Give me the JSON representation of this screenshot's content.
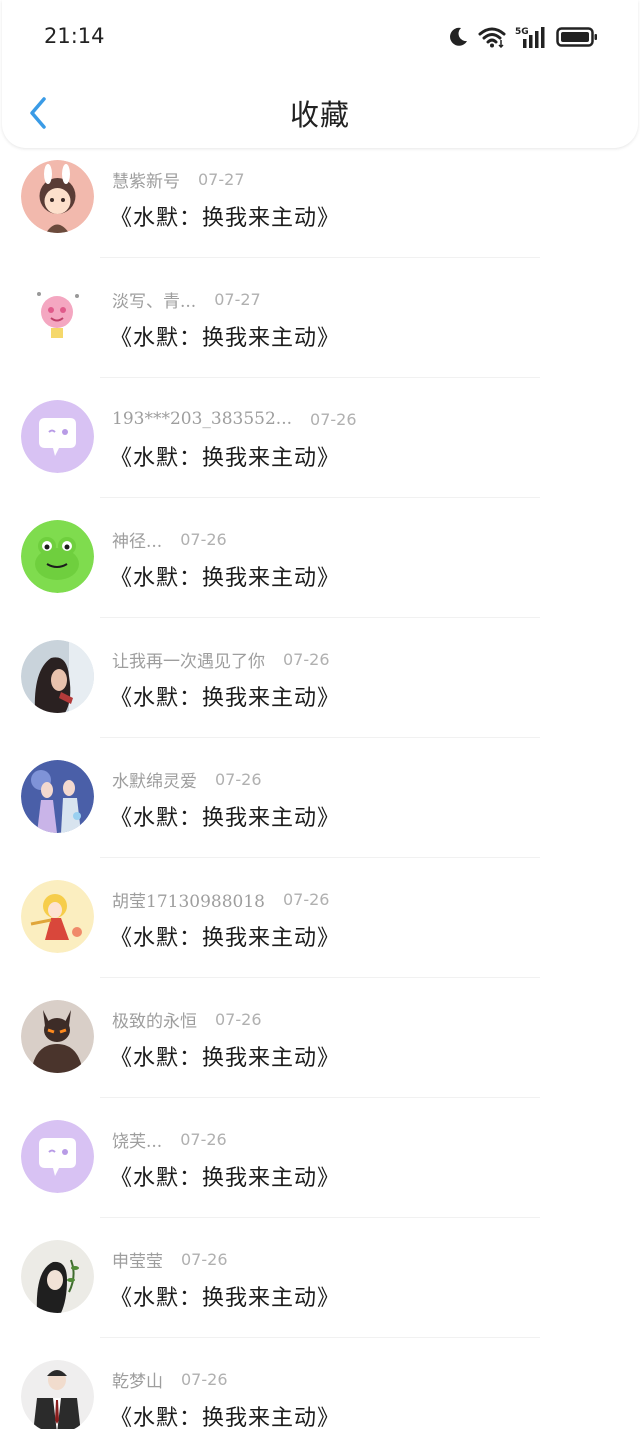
{
  "status_bar": {
    "time": "21:14",
    "network": "5G"
  },
  "header": {
    "title": "收藏",
    "back_icon": "chevron-left-icon",
    "back_color": "#3a9be6"
  },
  "favorites": [
    {
      "user": "慧紫新号",
      "date": "07-27",
      "title": "《水默：换我来主动》",
      "avatar": "anime-girl"
    },
    {
      "user": "淡写、青...",
      "date": "07-27",
      "title": "《水默：换我来主动》",
      "avatar": "pink-cartoon"
    },
    {
      "user": "193***203_383552...",
      "date": "07-26",
      "title": "《水默：换我来主动》",
      "avatar": "default-chat"
    },
    {
      "user": "神径...",
      "date": "07-26",
      "title": "《水默：换我来主动》",
      "avatar": "green-frog"
    },
    {
      "user": "让我再一次遇见了你",
      "date": "07-26",
      "title": "《水默：换我来主动》",
      "avatar": "photo-girl"
    },
    {
      "user": "水默绵灵爱",
      "date": "07-26",
      "title": "《水默：换我来主动》",
      "avatar": "anime-couple"
    },
    {
      "user": "胡莹17130988018",
      "date": "07-26",
      "title": "《水默：换我来主动》",
      "avatar": "yellow-character"
    },
    {
      "user": "极致的永恒",
      "date": "07-26",
      "title": "《水默：换我来主动》",
      "avatar": "dark-hero"
    },
    {
      "user": "饶芙...",
      "date": "07-26",
      "title": "《水默：换我来主动》",
      "avatar": "default-chat"
    },
    {
      "user": "申莹莹",
      "date": "07-26",
      "title": "《水默：换我来主动》",
      "avatar": "sketch-girl"
    },
    {
      "user": "乾梦山",
      "date": "07-26",
      "title": "《水默：换我来主动》",
      "avatar": "suit-man"
    }
  ]
}
